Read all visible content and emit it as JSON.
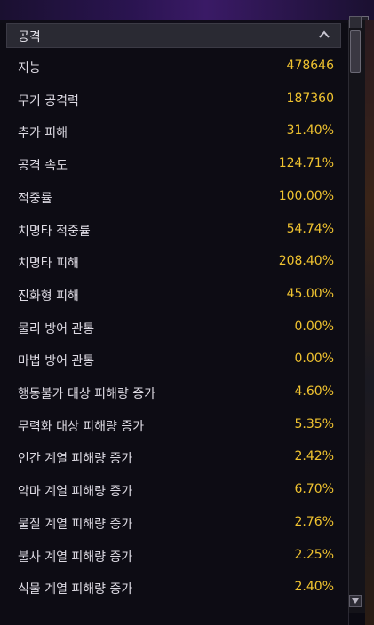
{
  "section": {
    "title": "공격"
  },
  "stats": [
    {
      "label": "지능",
      "value": "478646"
    },
    {
      "label": "무기 공격력",
      "value": "187360"
    },
    {
      "label": "추가 피해",
      "value": "31.40%"
    },
    {
      "label": "공격 속도",
      "value": "124.71%"
    },
    {
      "label": "적중률",
      "value": "100.00%"
    },
    {
      "label": "치명타 적중률",
      "value": "54.74%"
    },
    {
      "label": "치명타 피해",
      "value": "208.40%"
    },
    {
      "label": "진화형 피해",
      "value": "45.00%"
    },
    {
      "label": "물리 방어 관통",
      "value": "0.00%"
    },
    {
      "label": "마법 방어 관통",
      "value": "0.00%"
    },
    {
      "label": "행동불가 대상 피해량 증가",
      "value": "4.60%"
    },
    {
      "label": "무력화 대상 피해량 증가",
      "value": "5.35%"
    },
    {
      "label": "인간 계열 피해량 증가",
      "value": "2.42%"
    },
    {
      "label": "악마 계열 피해량 증가",
      "value": "6.70%"
    },
    {
      "label": "물질 계열 피해량 증가",
      "value": "2.76%"
    },
    {
      "label": "불사 계열 피해량 증가",
      "value": "2.25%"
    },
    {
      "label": "식물 계열 피해량 증가",
      "value": "2.40%"
    }
  ],
  "icons": {
    "collapse": "chevron-up-icon",
    "close": "close-icon",
    "scroll_up": "arrow-up-icon",
    "scroll_down": "arrow-down-icon"
  },
  "colors": {
    "label": "#dedbe4",
    "value": "#f0c330",
    "header_bg": "#2a2a33"
  }
}
